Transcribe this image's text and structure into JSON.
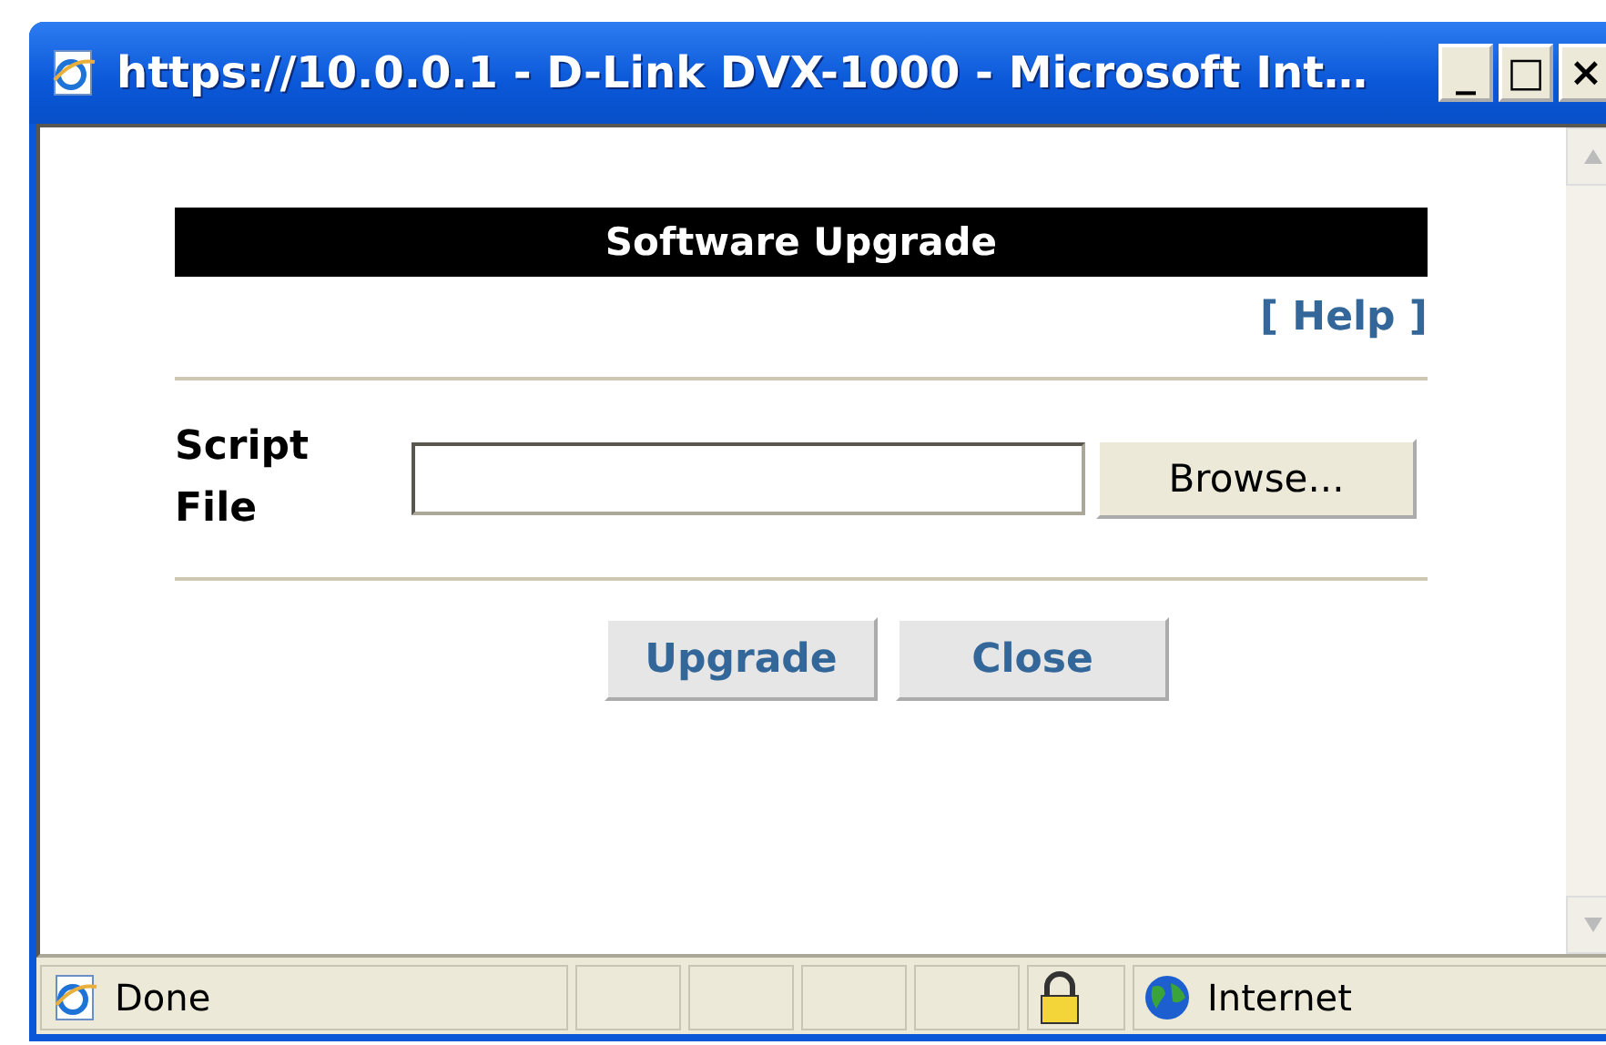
{
  "window": {
    "title": "https://10.0.0.1 - D-Link DVX-1000 - Microsoft Int…",
    "controls": [
      "_",
      "□",
      "×"
    ]
  },
  "page": {
    "heading": "Software Upgrade",
    "help_link": "[ Help ]",
    "field_label": "Script File",
    "browse_button": "Browse...",
    "buttons": [
      "Upgrade",
      "Close"
    ]
  },
  "status_bar": {
    "text": "Done",
    "zone": "Internet"
  }
}
